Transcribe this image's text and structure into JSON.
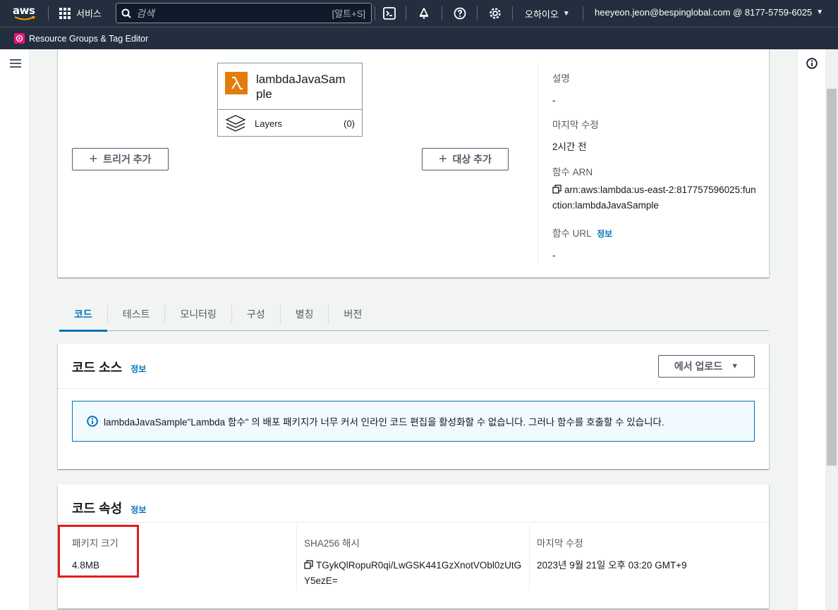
{
  "topnav": {
    "logo": "aws",
    "services_label": "서비스",
    "search_placeholder": "검색",
    "search_shortcut": "[알트+S]",
    "region": "오하이오",
    "account": "heeyeon.jeon@bespinglobal.com @ 8177-5759-6025"
  },
  "favorites": [
    {
      "label": "Resource Groups & Tag Editor"
    }
  ],
  "overview": {
    "function_name": "lambdaJavaSample",
    "layers_label": "Layers",
    "layers_count": "(0)",
    "add_trigger": "트리거 추가",
    "add_destination": "대상 추가",
    "description_label": "설명",
    "description_value": "-",
    "last_modified_label": "마지막 수정",
    "last_modified_value": "2시간 전",
    "arn_label": "함수 ARN",
    "arn_value": "arn:aws:lambda:us-east-2:817757596025:function:lambdaJavaSample",
    "url_label": "함수 URL",
    "url_info": "정보",
    "url_value": "-"
  },
  "tabs": [
    {
      "label": "코드",
      "active": true
    },
    {
      "label": "테스트"
    },
    {
      "label": "모니터링"
    },
    {
      "label": "구성"
    },
    {
      "label": "별칭"
    },
    {
      "label": "버전"
    }
  ],
  "code_source": {
    "title": "코드 소스",
    "info": "정보",
    "upload_label": "에서 업로드",
    "alert_text": "lambdaJavaSample\"Lambda 함수\" 의 배포 패키지가 너무 커서 인라인 코드 편집을 활성화할 수 없습니다. 그러나 함수를 호출할 수 있습니다."
  },
  "code_properties": {
    "title": "코드 속성",
    "info": "정보",
    "package_size_label": "패키지 크기",
    "package_size_value": "4.8MB",
    "sha_label": "SHA256 해시",
    "sha_value": "TGykQlRopuR0qi/LwGSK441GzXnotVObl0zUtGY5ezE=",
    "modified_label": "마지막 수정",
    "modified_value": "2023년 9월 21일 오후 03:20 GMT+9"
  },
  "colors": {
    "nav_bg": "#232f3e",
    "link": "#0073bb",
    "lambda_orange": "#e27d0c",
    "highlight": "#e31b1b"
  }
}
